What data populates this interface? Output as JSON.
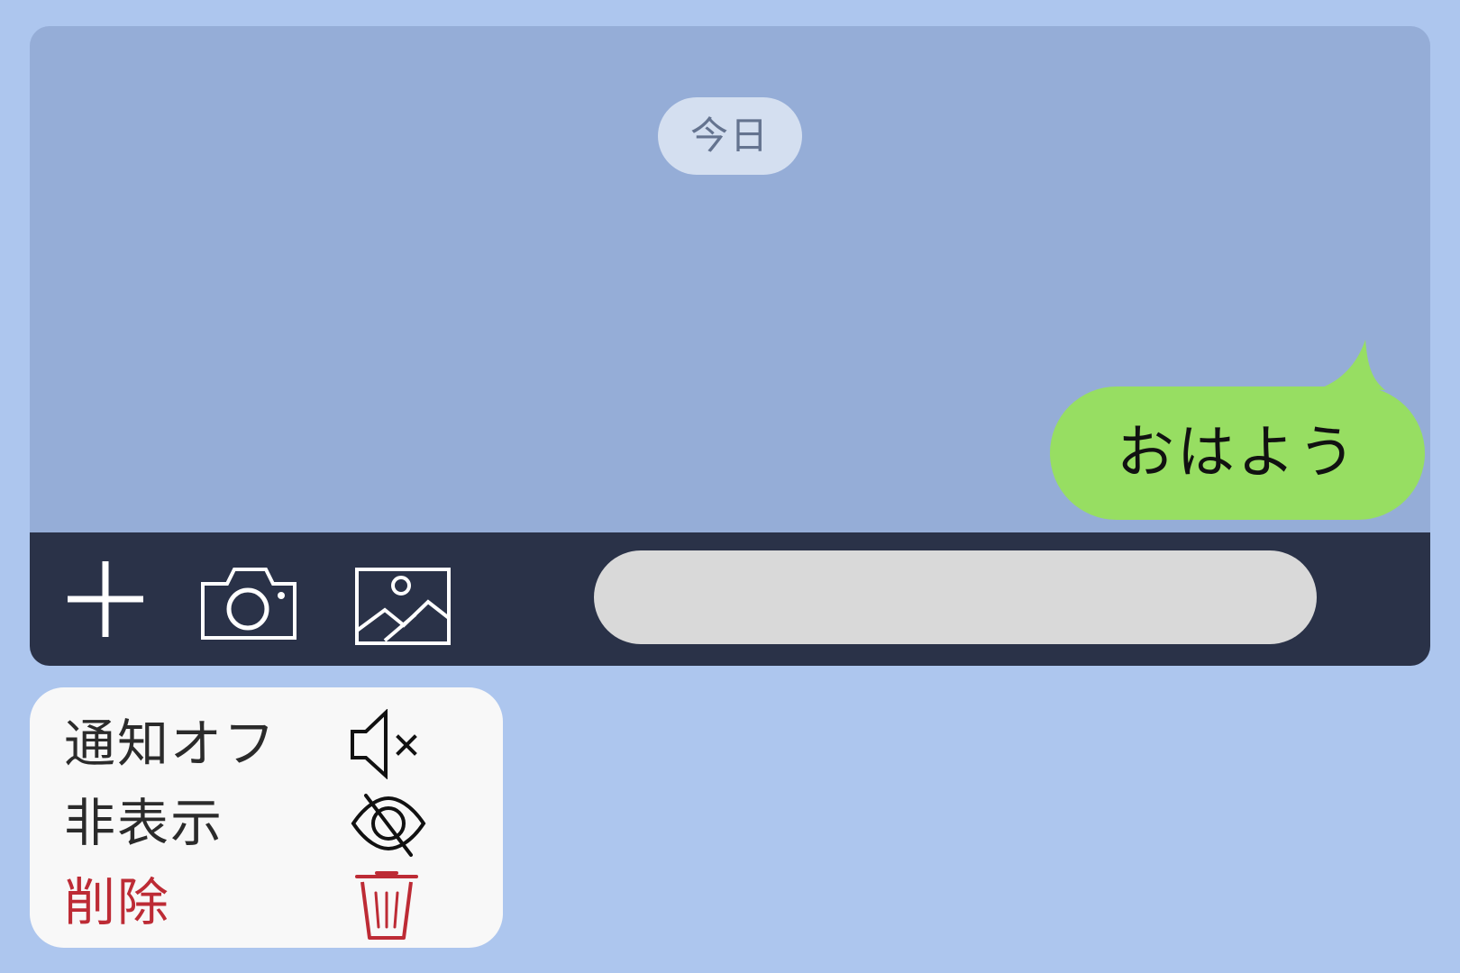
{
  "chat": {
    "date_label": "今日",
    "messages": [
      {
        "sender": "self",
        "text": "おはよう"
      }
    ]
  },
  "toolbar": {
    "actions": [
      {
        "icon": "plus-icon"
      },
      {
        "icon": "camera-icon"
      },
      {
        "icon": "image-icon"
      }
    ],
    "message_input": {
      "value": "",
      "placeholder": ""
    }
  },
  "context_menu": {
    "items": [
      {
        "label": "通知オフ",
        "icon": "mute-speaker-icon"
      },
      {
        "label": "非表示",
        "icon": "eye-off-icon"
      },
      {
        "label": "削除",
        "icon": "trash-icon"
      }
    ]
  },
  "colors": {
    "page_background": "#adc6ee",
    "chat_background": "#95add7",
    "bubble": "#97de62",
    "toolbar": "#2a3248",
    "input": "#d9d9d9",
    "menu_background": "#f8f8f8",
    "delete_accent": "#bd2b35"
  }
}
